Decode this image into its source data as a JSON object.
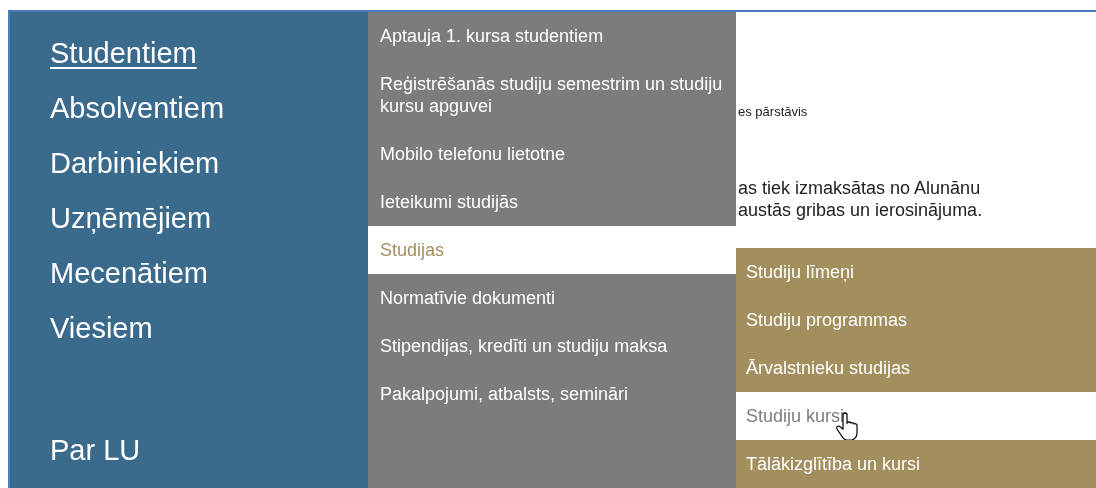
{
  "main_nav": {
    "items": [
      {
        "label": "Studentiem",
        "selected": true
      },
      {
        "label": "Absolventiem",
        "selected": false
      },
      {
        "label": "Darbiniekiem",
        "selected": false
      },
      {
        "label": "Uzņēmējiem",
        "selected": false
      },
      {
        "label": "Mecenātiem",
        "selected": false
      },
      {
        "label": "Viesiem",
        "selected": false
      }
    ],
    "footer_item": {
      "label": "Par LU"
    }
  },
  "submenu": {
    "items": [
      {
        "label": "Aptauja 1. kursa studentiem",
        "selected": false
      },
      {
        "label": "Reģistrēšanās studiju semestrim un studiju kursu apguvei",
        "selected": false
      },
      {
        "label": "Mobilo telefonu lietotne",
        "selected": false
      },
      {
        "label": "Ieteikumi studijās",
        "selected": false
      },
      {
        "label": "Studijas",
        "selected": true
      },
      {
        "label": "Normatīvie dokumenti",
        "selected": false
      },
      {
        "label": "Stipendijas, kredīti un studiju maksa",
        "selected": false
      },
      {
        "label": "Pakalpojumi, atbalsts, semināri",
        "selected": false
      }
    ]
  },
  "sub_submenu": {
    "items": [
      {
        "label": "Studiju līmeņi",
        "selected": false
      },
      {
        "label": "Studiju programmas",
        "selected": false
      },
      {
        "label": "Ārvalstnieku studijas",
        "selected": false
      },
      {
        "label": "Studiju kursi",
        "selected": true
      },
      {
        "label": "Tālākizglītība un kursi",
        "selected": false
      }
    ]
  },
  "page_content": {
    "caption": "es pārstāvis",
    "paragraph_lines": [
      "as tiek izmaksātas no Alunānu",
      "austās gribas un ierosinājuma."
    ]
  }
}
